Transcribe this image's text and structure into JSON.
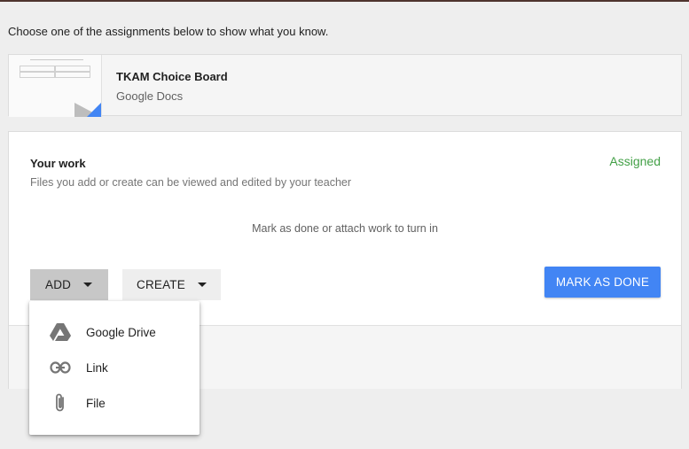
{
  "instructions": "Choose one of the assignments below to show what you know.",
  "attachment": {
    "title": "TKAM Choice Board",
    "source": "Google Docs"
  },
  "your_work": {
    "title": "Your work",
    "description": "Files you add or create can be viewed and edited by your teacher",
    "status": "Assigned",
    "hint": "Mark as done or attach work to turn in",
    "add_label": "ADD",
    "create_label": "CREATE",
    "mark_done_label": "MARK AS DONE"
  },
  "add_menu": {
    "items": [
      {
        "label": "Google Drive",
        "icon": "google-drive-icon"
      },
      {
        "label": "Link",
        "icon": "link-icon"
      },
      {
        "label": "File",
        "icon": "paperclip-icon"
      }
    ]
  },
  "colors": {
    "accent_blue": "#4285f4",
    "status_green": "#43a047",
    "top_bar": "#4e342e"
  }
}
